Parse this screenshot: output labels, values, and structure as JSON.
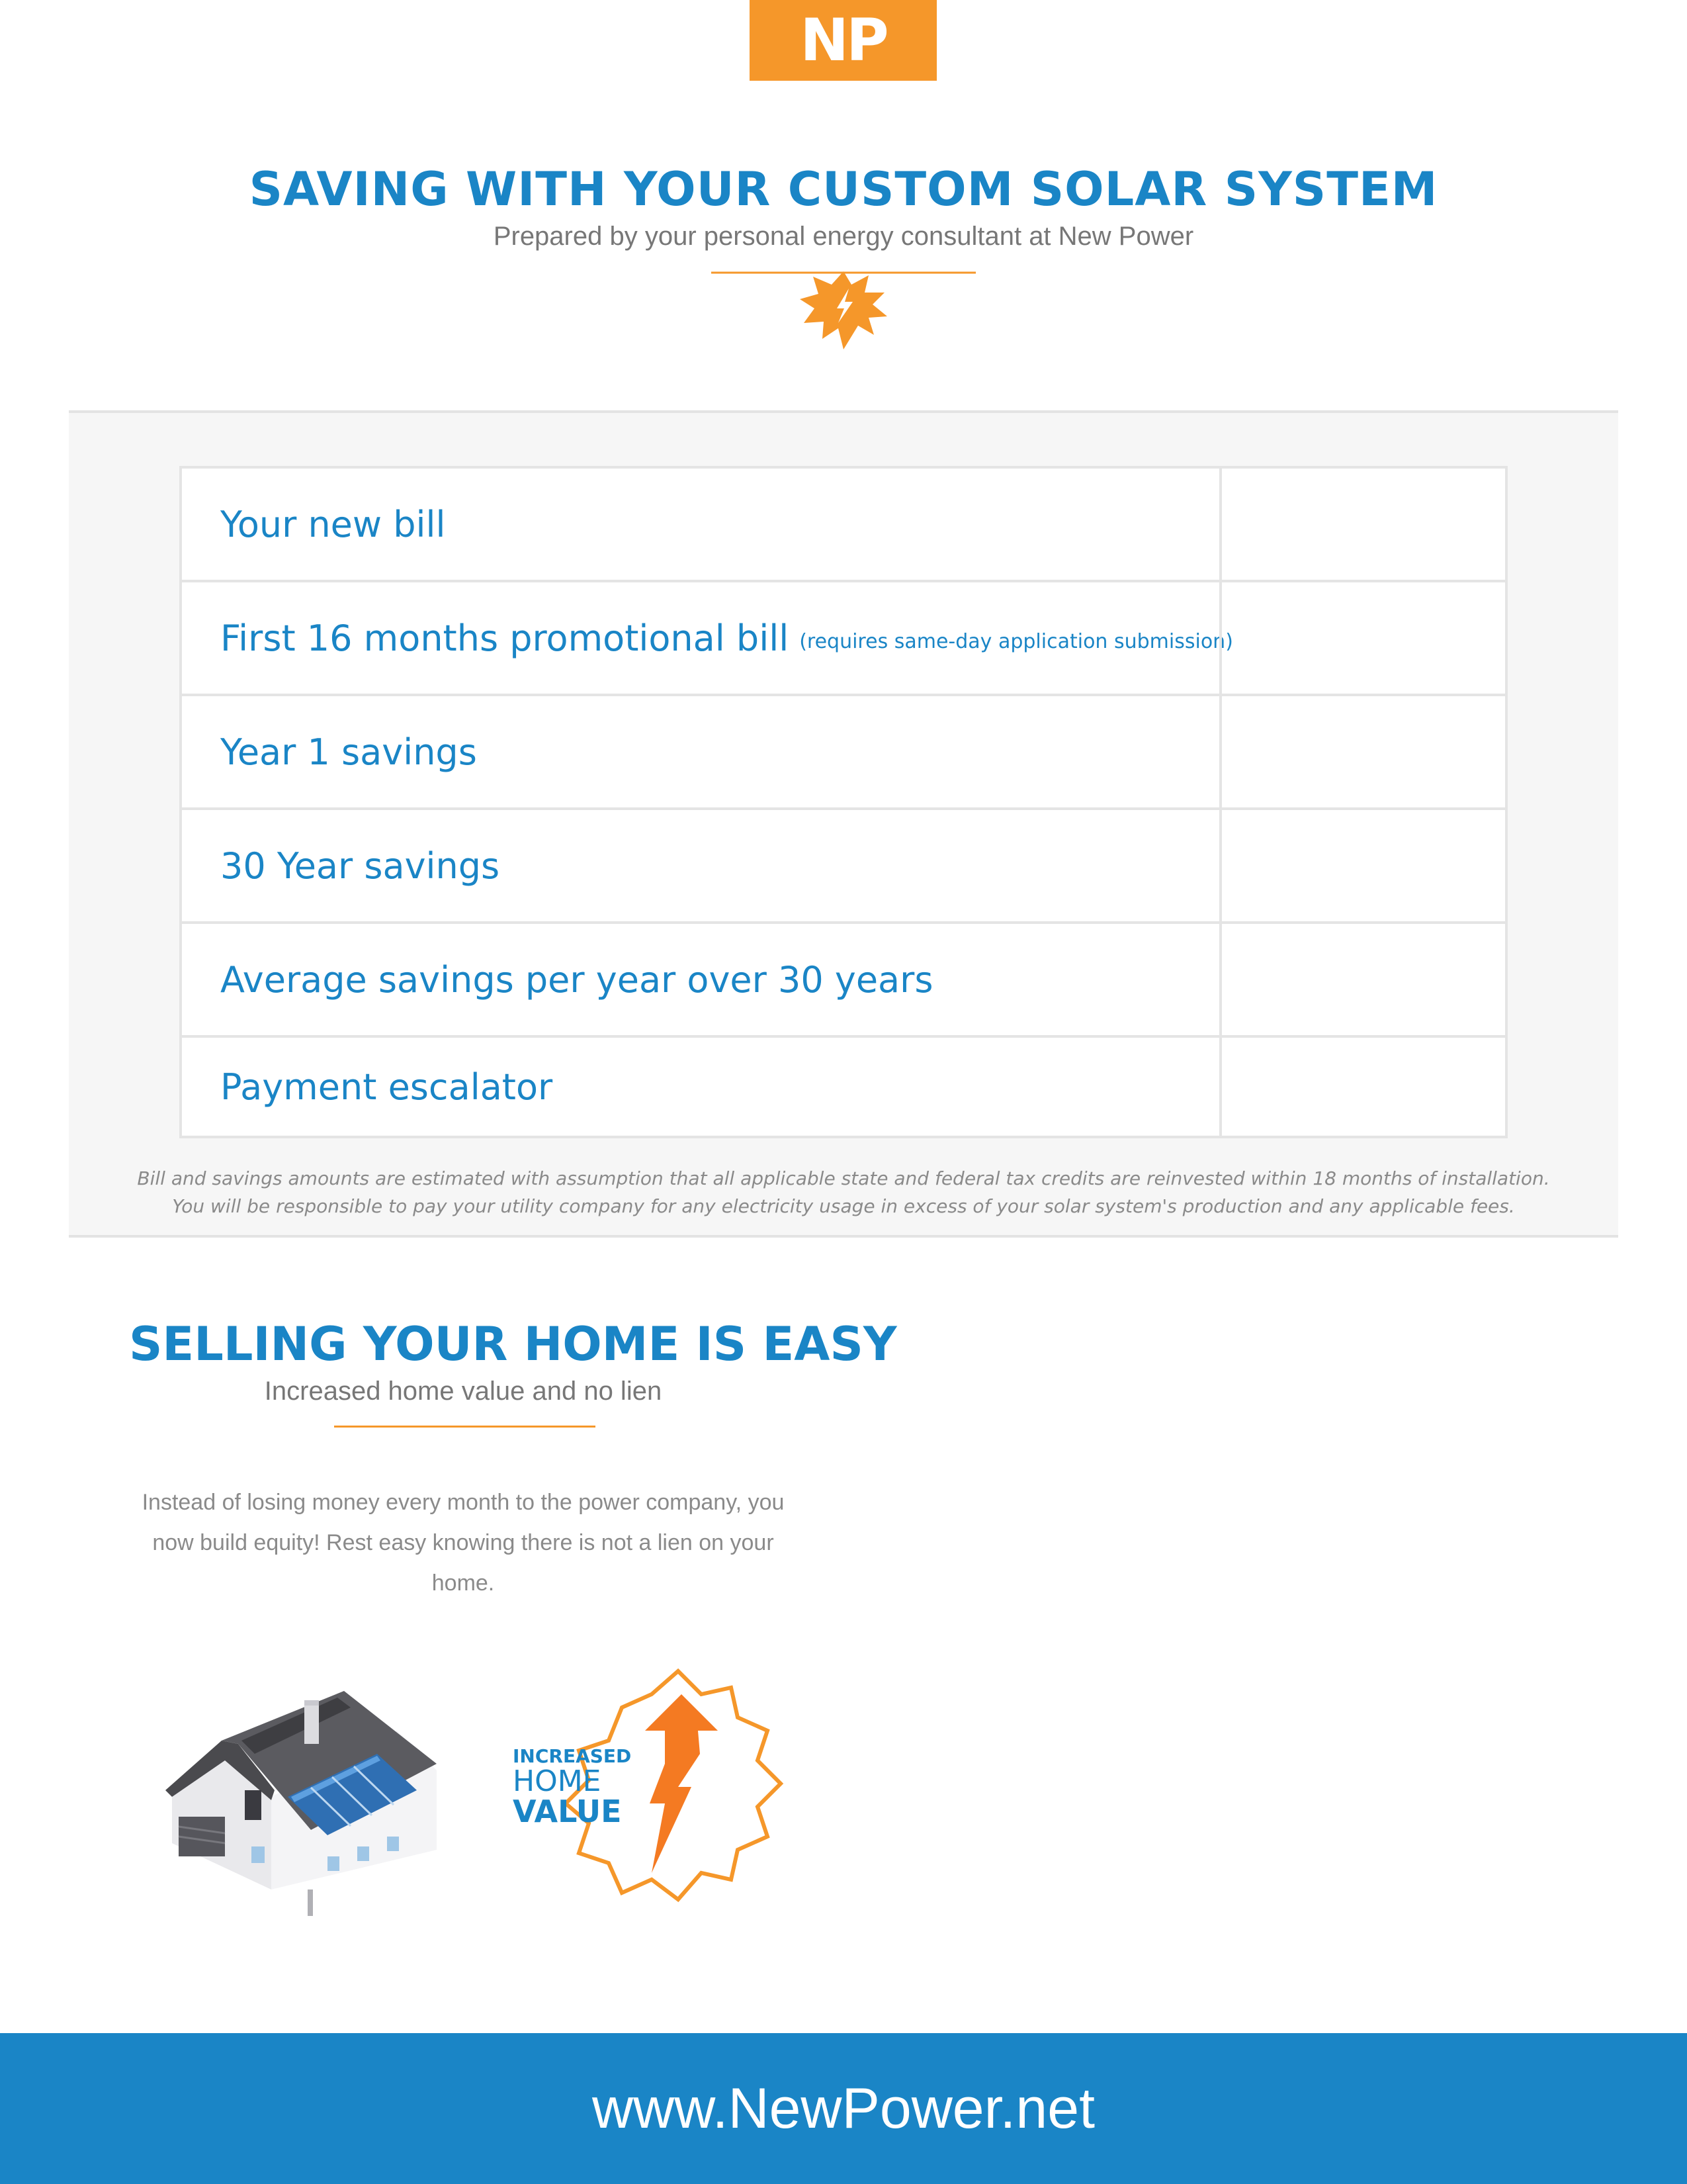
{
  "logo": {
    "text": "NP"
  },
  "header": {
    "title": "SAVING WITH YOUR CUSTOM SOLAR SYSTEM",
    "subtitle": "Prepared by your personal energy consultant at New Power"
  },
  "savings_table": {
    "rows": [
      {
        "label": "Your new bill",
        "note": "",
        "value": ""
      },
      {
        "label": "First 16 months promotional bill",
        "note": "(requires same-day application submission)",
        "value": ""
      },
      {
        "label": "Year 1 savings",
        "note": "",
        "value": ""
      },
      {
        "label": "30 Year savings",
        "note": "",
        "value": ""
      },
      {
        "label": "Average savings per year over 30 years",
        "note": "",
        "value": ""
      },
      {
        "label": "Payment escalator",
        "note": "",
        "value": ""
      }
    ],
    "disclaimer_1": "Bill and savings amounts are estimated with assumption that all applicable state and federal tax credits are reinvested within 18 months of installation.",
    "disclaimer_2": "You will be responsible to pay your utility company for any electricity usage in excess of your solar system's production and any applicable fees."
  },
  "selling_section": {
    "title": "SELLING YOUR HOME IS EASY",
    "subtitle": "Increased home value and no lien",
    "body": "Instead of losing money every month to the power company, you now build equity!  Rest easy knowing there is not a lien on your home."
  },
  "badge": {
    "line_1": "INCREASED",
    "line_2": "HOME",
    "line_3": "VALUE"
  },
  "footer": {
    "url": "www.NewPower.net"
  },
  "colors": {
    "brand_blue": "#1a85c6",
    "brand_orange": "#f5972a",
    "panel_gray": "#f6f6f6"
  },
  "icons": [
    "np-logo",
    "lightning-burst-icon",
    "house-solar-icon",
    "increased-home-value-badge-icon"
  ]
}
